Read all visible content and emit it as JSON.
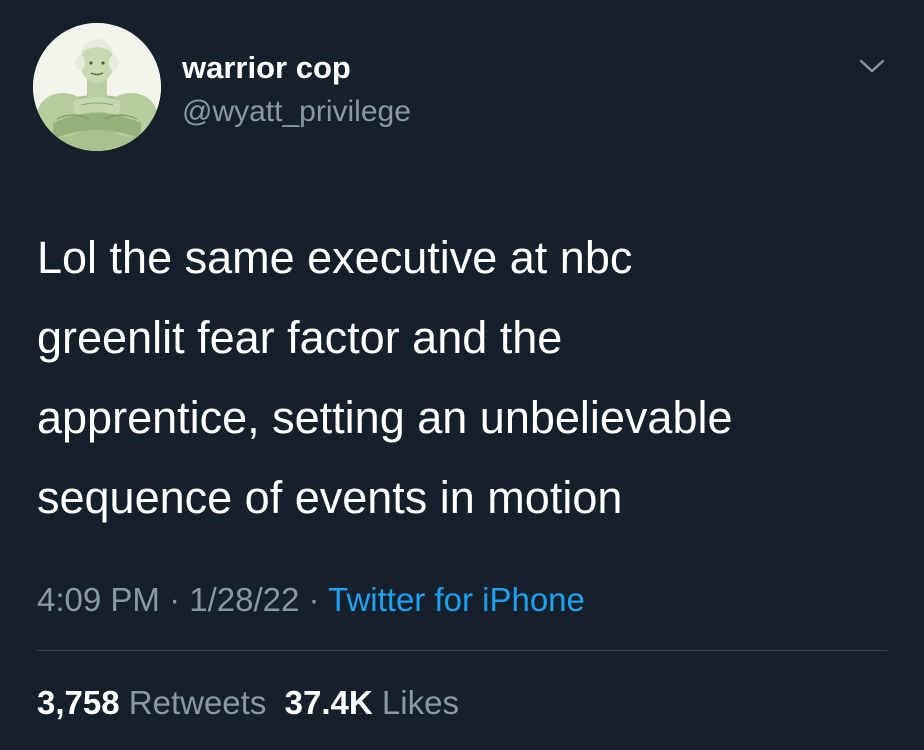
{
  "author": {
    "display_name": "warrior cop",
    "handle": "@wyatt_privilege",
    "avatar_icon": "muscular-george-washington-avatar"
  },
  "more_icon": "chevron-down-icon",
  "tweet": {
    "lines": [
      "Lol the same executive at nbc",
      "greenlit fear factor and the",
      "apprentice, setting an unbelievable",
      "sequence of events in motion"
    ]
  },
  "meta": {
    "time": "4:09 PM",
    "separator": "·",
    "date": "1/28/22",
    "source": "Twitter for iPhone"
  },
  "stats": {
    "retweets_count": "3,758",
    "retweets_label": "Retweets",
    "likes_count": "37.4K",
    "likes_label": "Likes"
  },
  "colors": {
    "background": "#15202b",
    "primary_text": "#ffffff",
    "secondary_text": "#8899a6",
    "link": "#1da1f2",
    "divider": "#38444d"
  }
}
